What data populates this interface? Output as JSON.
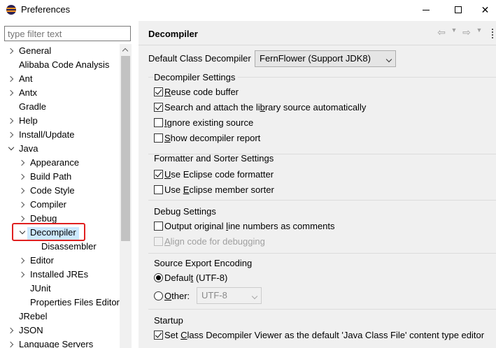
{
  "window": {
    "title": "Preferences"
  },
  "filter": {
    "placeholder": "type filter text"
  },
  "tree": {
    "items": [
      {
        "label": "General",
        "expander": "collapsed"
      },
      {
        "label": "Alibaba Code Analysis",
        "expander": "none"
      },
      {
        "label": "Ant",
        "expander": "collapsed"
      },
      {
        "label": "Antx",
        "expander": "collapsed"
      },
      {
        "label": "Gradle",
        "expander": "none"
      },
      {
        "label": "Help",
        "expander": "collapsed"
      },
      {
        "label": "Install/Update",
        "expander": "collapsed"
      },
      {
        "label": "Java",
        "expander": "expanded"
      },
      {
        "label": "Appearance",
        "expander": "collapsed"
      },
      {
        "label": "Build Path",
        "expander": "collapsed"
      },
      {
        "label": "Code Style",
        "expander": "collapsed"
      },
      {
        "label": "Compiler",
        "expander": "collapsed"
      },
      {
        "label": "Debug",
        "expander": "collapsed"
      },
      {
        "label": "Decompiler",
        "expander": "expanded",
        "selected": true
      },
      {
        "label": "Disassembler",
        "expander": "none"
      },
      {
        "label": "Editor",
        "expander": "collapsed"
      },
      {
        "label": "Installed JREs",
        "expander": "collapsed"
      },
      {
        "label": "JUnit",
        "expander": "none"
      },
      {
        "label": "Properties Files Editor",
        "expander": "none"
      },
      {
        "label": "JRebel",
        "expander": "none"
      },
      {
        "label": "JSON",
        "expander": "collapsed"
      },
      {
        "label": "Language Servers",
        "expander": "collapsed"
      }
    ]
  },
  "page": {
    "title": "Decompiler",
    "default_decompiler_label": "Default Class Decompiler",
    "default_decompiler_value": "FernFlower (Support JDK8)",
    "groups": {
      "decompiler_settings": {
        "title": "Decompiler Settings",
        "options": [
          {
            "pre": "",
            "key": "R",
            "post": "euse code buffer",
            "checked": true
          },
          {
            "pre": "Search and attach the li",
            "key": "b",
            "post": "rary source automatically",
            "checked": true
          },
          {
            "pre": "",
            "key": "I",
            "post": "gnore existing source",
            "checked": false
          },
          {
            "pre": "",
            "key": "S",
            "post": "how decompiler report",
            "checked": false
          }
        ]
      },
      "formatter_settings": {
        "title": "Formatter and Sorter Settings",
        "options": [
          {
            "pre": "",
            "key": "U",
            "post": "se Eclipse code formatter",
            "checked": true
          },
          {
            "pre": "Use ",
            "key": "E",
            "post": "clipse member sorter",
            "checked": false
          }
        ]
      },
      "debug_settings": {
        "title": "Debug Settings",
        "options": [
          {
            "pre": "Output original ",
            "key": "l",
            "post": "ine numbers as comments",
            "checked": false
          },
          {
            "pre": "",
            "key": "A",
            "post": "lign code for debugging",
            "checked": false,
            "disabled": true
          }
        ]
      },
      "source_export_encoding": {
        "title": "Source Export Encoding",
        "default_pre": "Defaul",
        "default_key": "t",
        "default_post": " (UTF-8)",
        "default_selected": true,
        "other_key": "O",
        "other_post": "ther:",
        "other_value": "UTF-8"
      },
      "startup": {
        "title": "Startup",
        "option_pre": "Set ",
        "option_key": "C",
        "option_post": "lass Decompiler Viewer as the default 'Java Class File' content type editor",
        "checked": true
      }
    }
  },
  "colors": {
    "selection": "#cce8ff",
    "highlight_box": "#e02020",
    "panel_bg": "#f0f0f0"
  }
}
